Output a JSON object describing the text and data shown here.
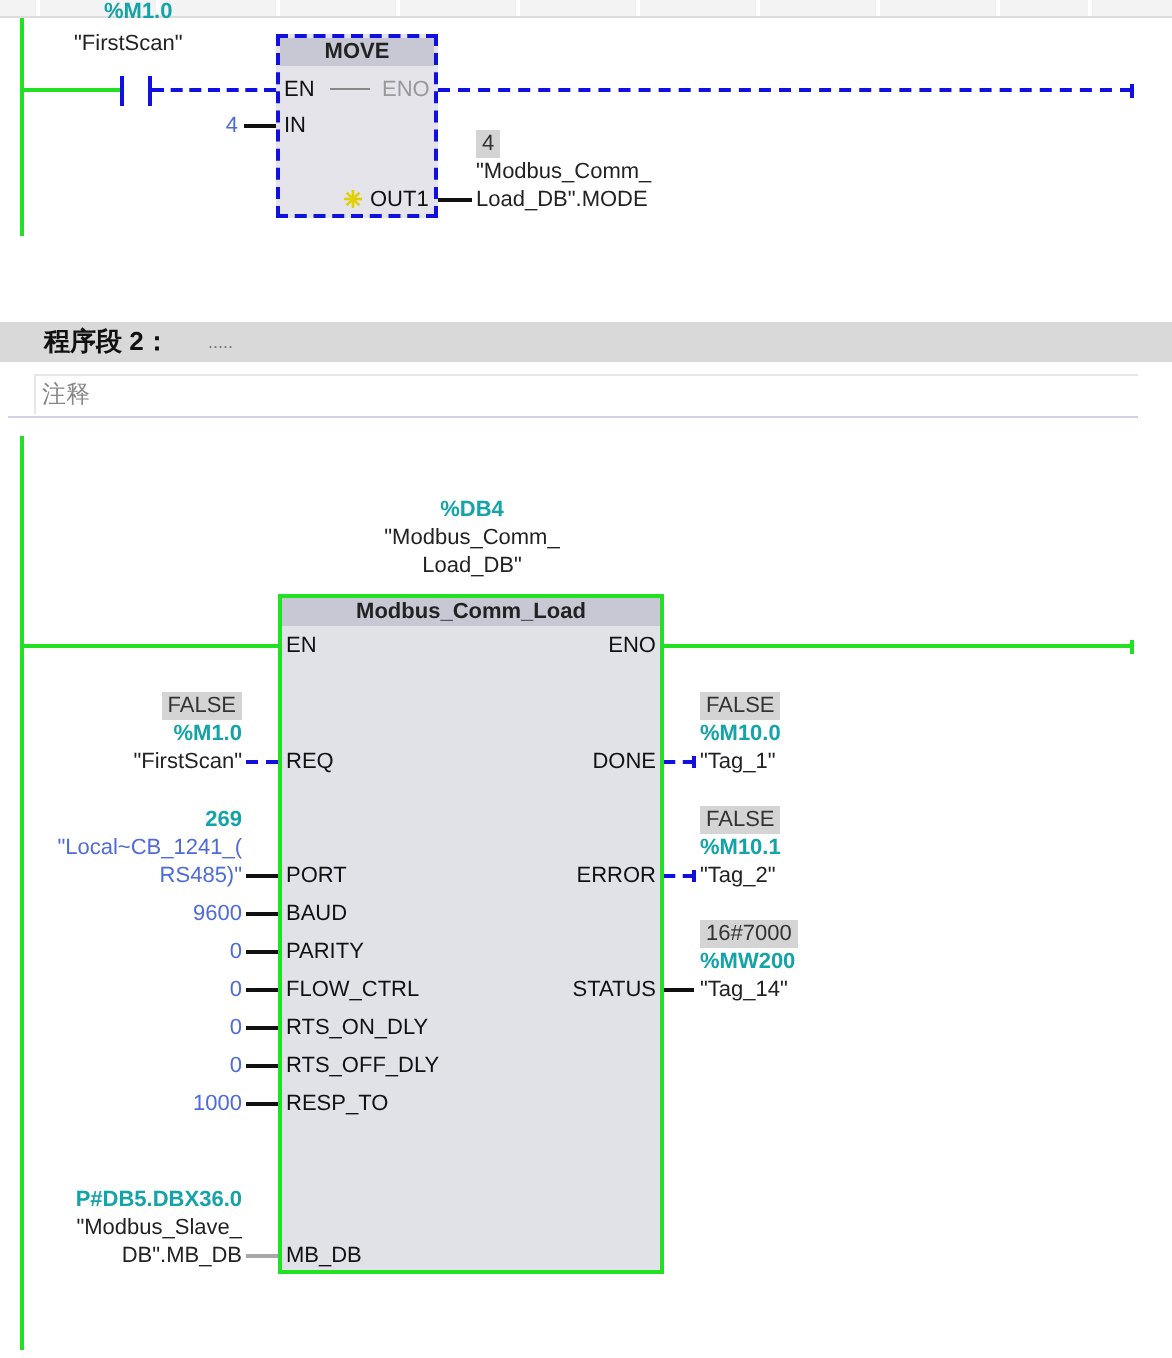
{
  "network_1": {
    "contact": {
      "address": "%M1.0",
      "tag": "\"FirstScan\"",
      "energized": false
    },
    "move_block": {
      "title": "MOVE",
      "energized": false,
      "en": "EN",
      "eno": "ENO",
      "in_pin": "IN",
      "in_value": "4",
      "out_pin": "OUT1",
      "out_lines": [
        {
          "kind": "monitor",
          "text": "4"
        },
        {
          "kind": "tag",
          "text": "\"Modbus_Comm_"
        },
        {
          "kind": "tag",
          "text": "Load_DB\".MODE"
        }
      ]
    }
  },
  "network_2": {
    "header": {
      "title": "程序段 2：",
      "dots": "....."
    },
    "comment": "注释",
    "instance": {
      "address": "%DB4",
      "name_lines": [
        "\"Modbus_Comm_",
        "Load_DB\""
      ]
    },
    "block": {
      "title": "Modbus_Comm_Load",
      "energized": true,
      "en": "EN",
      "eno": "ENO",
      "inputs": [
        {
          "pin": "REQ",
          "kind": "bool",
          "lines": [
            {
              "kind": "monitor",
              "text": "FALSE"
            },
            {
              "kind": "address",
              "text": "%M1.0"
            },
            {
              "kind": "tag",
              "text": "\"FirstScan\""
            }
          ]
        },
        {
          "pin": "PORT",
          "kind": "value",
          "lines": [
            {
              "kind": "address",
              "text": "269"
            },
            {
              "kind": "constant",
              "text": "\"Local~CB_1241_("
            },
            {
              "kind": "constant",
              "text": "RS485)\""
            }
          ]
        },
        {
          "pin": "BAUD",
          "kind": "value",
          "lines": [
            {
              "kind": "constant",
              "text": "9600"
            }
          ]
        },
        {
          "pin": "PARITY",
          "kind": "value",
          "lines": [
            {
              "kind": "constant",
              "text": "0"
            }
          ]
        },
        {
          "pin": "FLOW_CTRL",
          "kind": "value",
          "lines": [
            {
              "kind": "constant",
              "text": "0"
            }
          ]
        },
        {
          "pin": "RTS_ON_DLY",
          "kind": "value",
          "lines": [
            {
              "kind": "constant",
              "text": "0"
            }
          ]
        },
        {
          "pin": "RTS_OFF_DLY",
          "kind": "value",
          "lines": [
            {
              "kind": "constant",
              "text": "0"
            }
          ]
        },
        {
          "pin": "RESP_TO",
          "kind": "value",
          "lines": [
            {
              "kind": "constant",
              "text": "1000"
            }
          ]
        },
        {
          "pin": "MB_DB",
          "kind": "pointer",
          "lines": [
            {
              "kind": "address",
              "text": "P#DB5.DBX36.0"
            },
            {
              "kind": "tag",
              "text": "\"Modbus_Slave_"
            },
            {
              "kind": "tag",
              "text": "DB\".MB_DB"
            }
          ]
        }
      ],
      "outputs": [
        {
          "pin": "DONE",
          "kind": "bool",
          "lines": [
            {
              "kind": "monitor",
              "text": "FALSE"
            },
            {
              "kind": "address",
              "text": "%M10.0"
            },
            {
              "kind": "tag",
              "text": "\"Tag_1\""
            }
          ]
        },
        {
          "pin": "ERROR",
          "kind": "bool",
          "lines": [
            {
              "kind": "monitor",
              "text": "FALSE"
            },
            {
              "kind": "address",
              "text": "%M10.1"
            },
            {
              "kind": "tag",
              "text": "\"Tag_2\""
            }
          ]
        },
        {
          "pin": "STATUS",
          "kind": "value",
          "lines": [
            {
              "kind": "monitor",
              "text": "16#7000"
            },
            {
              "kind": "address",
              "text": "%MW200"
            },
            {
              "kind": "tag",
              "text": "\"Tag_14\""
            }
          ]
        }
      ]
    }
  }
}
